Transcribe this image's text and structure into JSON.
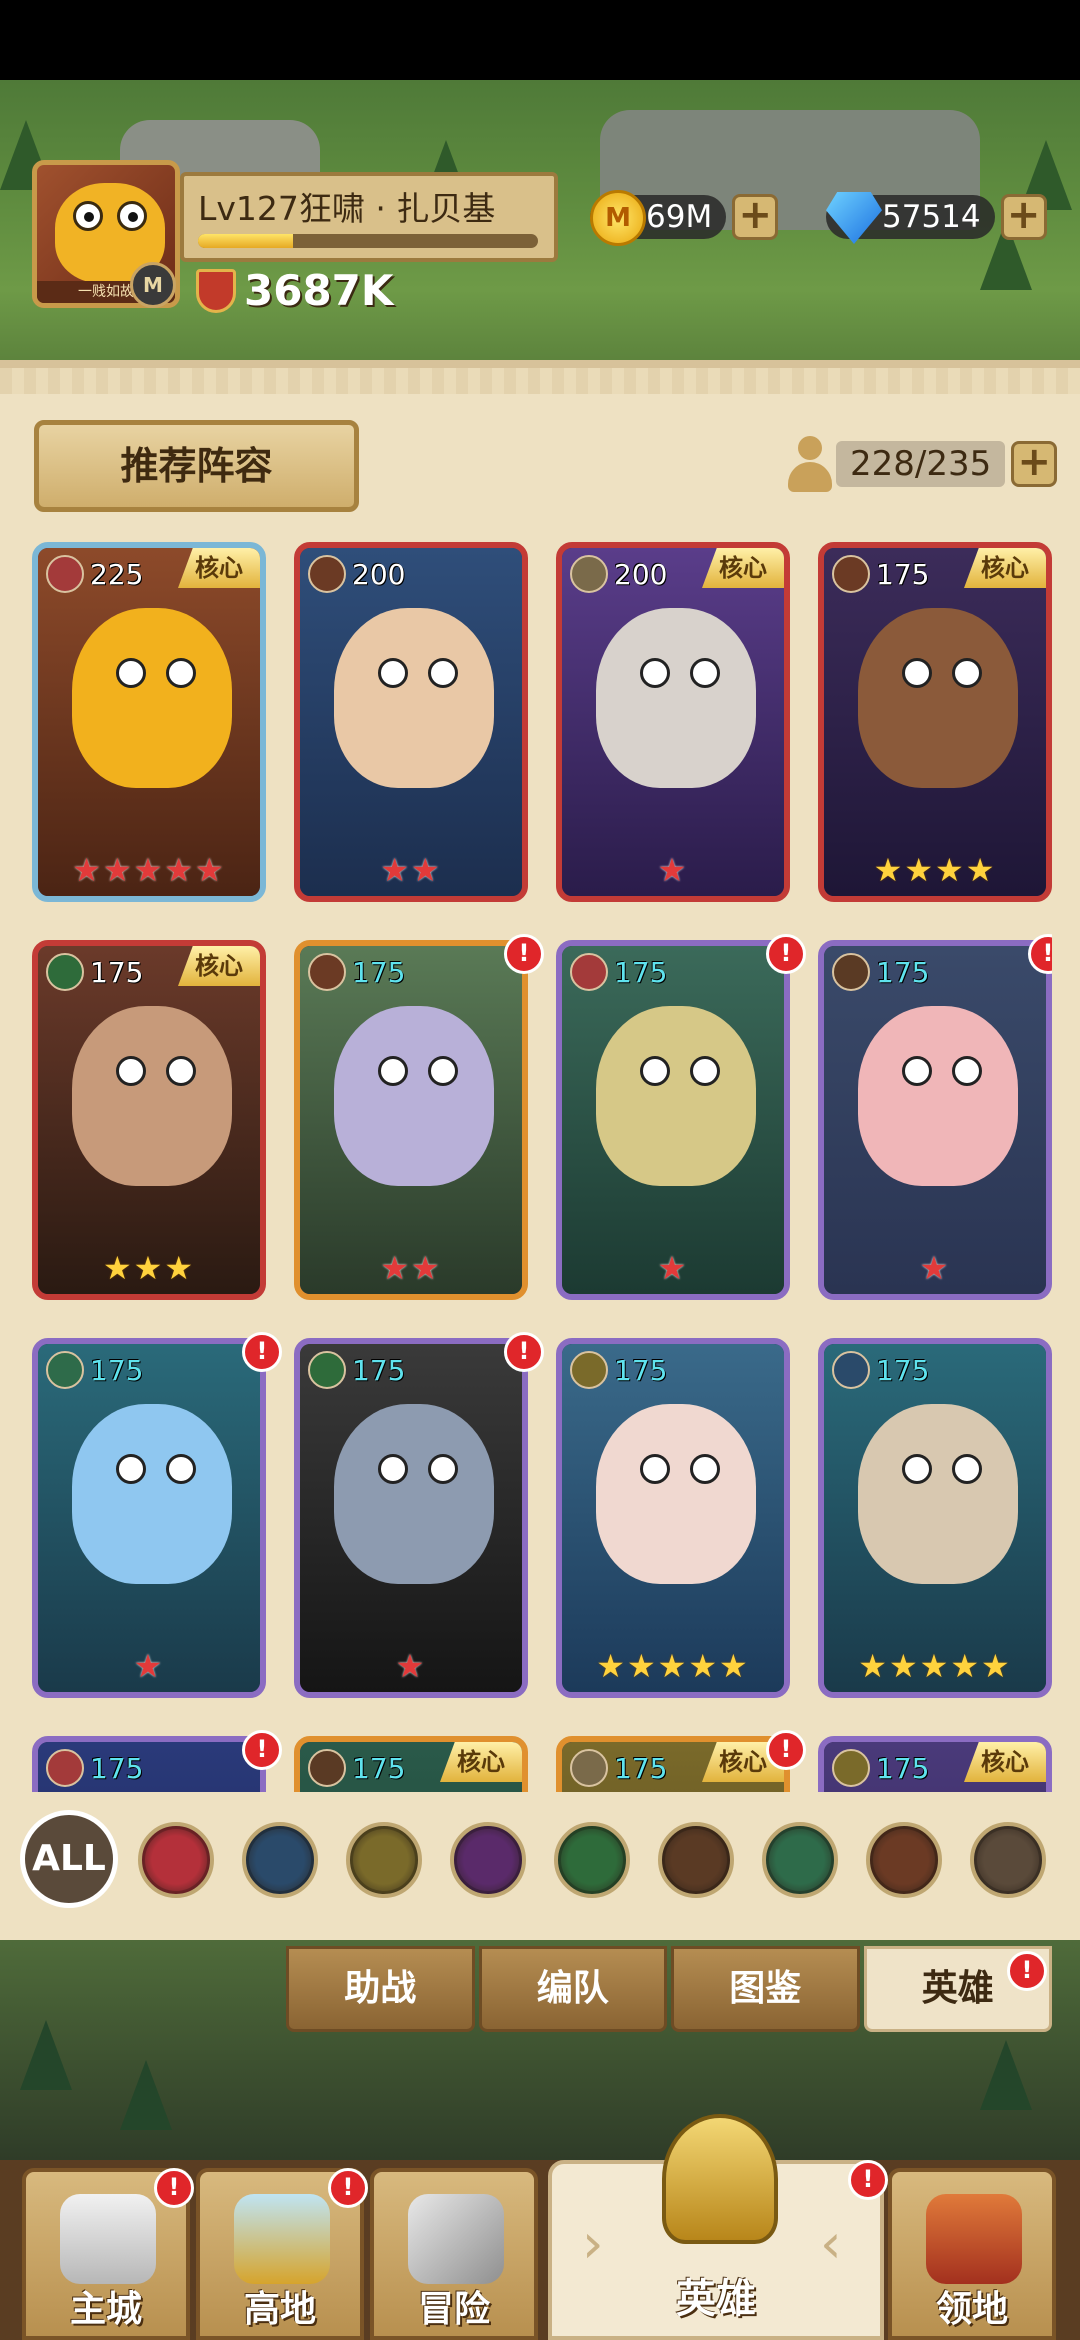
{
  "player": {
    "name": "Lv127狂啸 · 扎贝基",
    "avatar_tag": "一贱如故",
    "xp_fraction": 0.28,
    "power": "3687K"
  },
  "currency": {
    "gold": "69M",
    "gems": "57514"
  },
  "panel": {
    "recommend_label": "推荐阵容",
    "capacity": "228/235"
  },
  "heroes": [
    {
      "level": "225",
      "core": "核心",
      "alert": false,
      "stars": 5,
      "star_color": "red",
      "class": "shield-icon"
    },
    {
      "level": "200",
      "core": "",
      "alert": false,
      "stars": 2,
      "star_color": "red",
      "class": "beast-icon"
    },
    {
      "level": "200",
      "core": "核心",
      "alert": false,
      "stars": 1,
      "star_color": "red",
      "class": "axe-icon"
    },
    {
      "level": "175",
      "core": "核心",
      "alert": false,
      "stars": 4,
      "star_color": "gold",
      "class": "beast-icon"
    },
    {
      "level": "175",
      "core": "核心",
      "alert": false,
      "stars": 3,
      "star_color": "gold",
      "class": "sword-icon"
    },
    {
      "level": "175",
      "core": "",
      "alert": true,
      "stars": 2,
      "star_color": "red",
      "class": "beast-icon"
    },
    {
      "level": "175",
      "core": "",
      "alert": true,
      "stars": 1,
      "star_color": "red",
      "class": "shield-icon"
    },
    {
      "level": "175",
      "core": "",
      "alert": true,
      "stars": 1,
      "star_color": "red",
      "class": "paw-icon"
    },
    {
      "level": "175",
      "core": "",
      "alert": true,
      "stars": 1,
      "star_color": "red",
      "class": "bow-icon"
    },
    {
      "level": "175",
      "core": "",
      "alert": true,
      "stars": 1,
      "star_color": "red",
      "class": "sword-icon"
    },
    {
      "level": "175",
      "core": "",
      "alert": false,
      "stars": 5,
      "star_color": "gold",
      "class": "wings-icon"
    },
    {
      "level": "175",
      "core": "",
      "alert": false,
      "stars": 5,
      "star_color": "gold",
      "class": "staff-icon"
    },
    {
      "level": "175",
      "core": "",
      "alert": true,
      "stars": 0,
      "star_color": "red",
      "class": "shield-icon"
    },
    {
      "level": "175",
      "core": "核心",
      "alert": false,
      "stars": 0,
      "star_color": "red",
      "class": "paw-icon"
    },
    {
      "level": "175",
      "core": "核心",
      "alert": true,
      "stars": 0,
      "star_color": "red",
      "class": "axe-icon"
    },
    {
      "level": "175",
      "core": "核心",
      "alert": false,
      "stars": 0,
      "star_color": "red",
      "class": "wings-icon"
    }
  ],
  "filters": {
    "all_label": "ALL",
    "icons": [
      "shield-filter-icon",
      "staff-filter-icon",
      "wings-filter-icon",
      "skull-filter-icon",
      "swords-filter-icon",
      "paw-filter-icon",
      "bow-filter-icon",
      "ox-filter-icon",
      "hammer-filter-icon"
    ]
  },
  "tabs": [
    "助战",
    "编队",
    "图鉴",
    "英雄"
  ],
  "nav": [
    "主城",
    "高地",
    "冒险",
    "英雄",
    "领地"
  ],
  "colors": {
    "panel": "#eee1c2",
    "red_frame": "#c33b36",
    "purple_frame": "#8b6cc2",
    "gold": "#e2b33c"
  }
}
